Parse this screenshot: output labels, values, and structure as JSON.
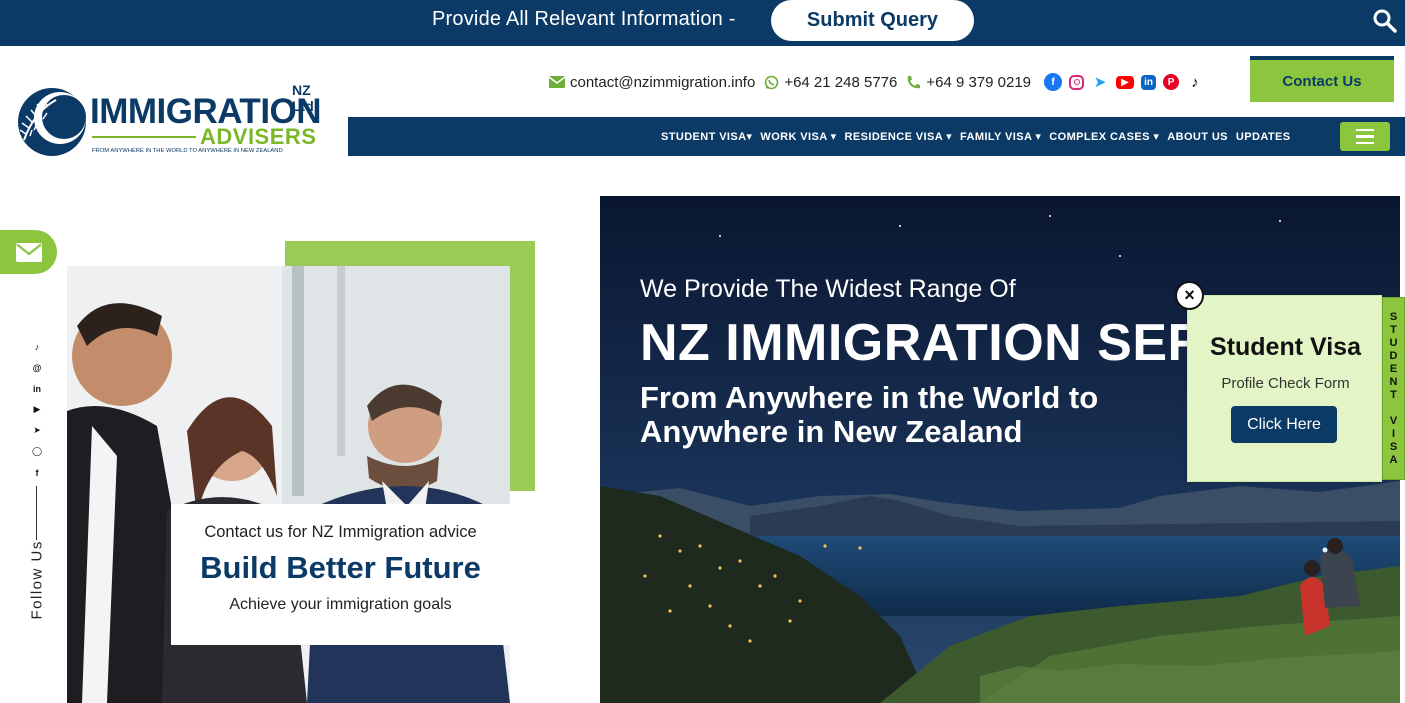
{
  "topbar": {
    "text": "Provide All Relevant Information -",
    "submit_label": "Submit Query",
    "search_icon": "search-icon"
  },
  "logo": {
    "nz_ltd": "NZ Ltd",
    "line1": "IMMIGRATION",
    "line2": "ADVISERS",
    "tagline": "FROM ANYWHERE IN THE WORLD TO ANYWHERE IN NEW ZEALAND"
  },
  "contacts": {
    "email": "contact@nzimmigration.info",
    "whatsapp": "+64 21 248 5776",
    "phone": "+64 9 379 0219",
    "social": [
      "facebook-icon",
      "instagram-icon",
      "twitter-icon",
      "youtube-icon",
      "linkedin-icon",
      "pinterest-icon",
      "tiktok-icon"
    ],
    "contact_button": "Contact Us"
  },
  "nav": {
    "items": [
      {
        "label": "STUDENT VISA",
        "dropdown": true
      },
      {
        "label": "WORK VISA",
        "dropdown": true
      },
      {
        "label": "RESIDENCE VISA",
        "dropdown": true
      },
      {
        "label": "FAMILY VISA",
        "dropdown": true
      },
      {
        "label": "COMPLEX CASES",
        "dropdown": true
      },
      {
        "label": "ABOUT US",
        "dropdown": false
      },
      {
        "label": "UPDATES",
        "dropdown": false
      }
    ],
    "menu_icon": "hamburger-icon"
  },
  "follow": {
    "label": "Follow Us",
    "icons": [
      "tiktok-icon",
      "threads-icon",
      "linkedin-icon",
      "youtube-icon",
      "twitter-icon",
      "instagram-icon",
      "facebook-icon"
    ]
  },
  "card": {
    "subtitle": "Contact us for NZ Immigration advice",
    "title": "Build Better Future",
    "note": "Achieve your immigration goals"
  },
  "hero": {
    "kicker": "We Provide The Widest Range Of",
    "title": "NZ IMMIGRATION SERVICES",
    "subtitle": "From Anywhere in the World to Anywhere in New Zealand"
  },
  "popup": {
    "close": "×",
    "title": "Student Visa",
    "subtitle": "Profile Check Form",
    "button": "Click Here",
    "side_tab": "S\nT\nU\nD\nE\nN\nT\n\nV\nI\nS\nA"
  },
  "colors": {
    "navy": "#0b3a66",
    "green": "#8cc63f",
    "light_green": "#e3f5c7"
  }
}
